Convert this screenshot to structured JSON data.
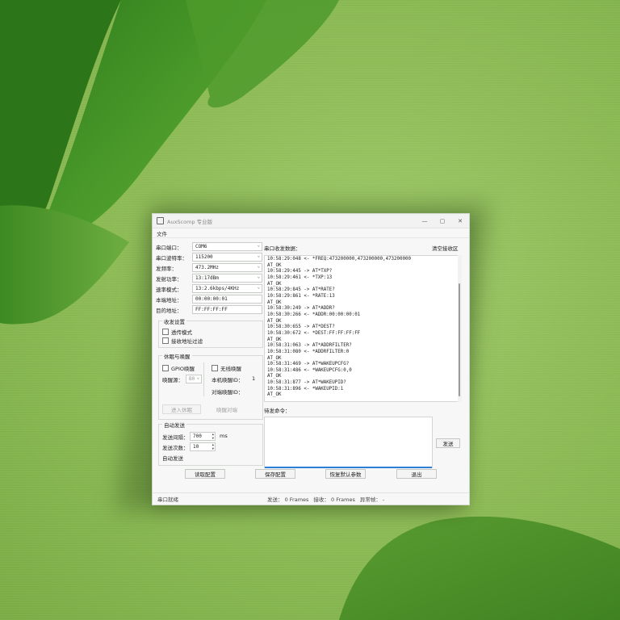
{
  "window": {
    "title": "AuxScomp 专业版"
  },
  "menu": {
    "items": [
      "文件"
    ]
  },
  "left": {
    "serial_port": {
      "label": "串口端口：",
      "value": "COM6"
    },
    "baud": {
      "label": "串口波特率：",
      "value": "115200"
    },
    "freq": {
      "label": "发频率：",
      "value": "473.2MHz"
    },
    "power": {
      "label": "发射功率：",
      "value": "13:17dBm"
    },
    "rate_mode": {
      "label": "速率模式：",
      "value": "13:2.6kbps/4KHz"
    },
    "local_addr": {
      "label": "本端地址：",
      "value": "00:00:00:01"
    },
    "dest_addr": {
      "label": "目的地址：",
      "value": "FF:FF:FF:FF"
    },
    "txrx_group": {
      "title": "收发设置",
      "transparent": "透传模式",
      "addr_filter": "接收地址过滤"
    },
    "sleep_group": {
      "title": "休眠与唤醒",
      "gpio": "GPIO唤醒",
      "wireless": "无线唤醒",
      "wake_source_label": "唤醒源：",
      "wake_source_value": "B0",
      "local_wake_id_label": "本机唤醒ID：",
      "local_wake_id_value": "1",
      "peer_wake_id_label": "对端唤醒ID：",
      "enter_sleep": "进入休眠",
      "wake_peer": "唤醒对端"
    },
    "auto_group": {
      "title": "自动发送",
      "interval_label": "发送间隔：",
      "interval_value": "700",
      "interval_unit": "ms",
      "count_label": "发送次数：",
      "count_value": "10",
      "auto_send": "自动发送"
    }
  },
  "right": {
    "log_title": "串口收发数据：",
    "clear_button": "清空接收区",
    "log_lines": [
      "10:58:29:048 <- *FREQ:473200000,473200000,473200000",
      "AT_OK",
      "10:58:29:445 -> AT*TXP?",
      "10:58:29:461 <- *TXP:13",
      "AT_OK",
      "10:58:29:845 -> AT*RATE?",
      "10:58:29:861 <- *RATE:13",
      "AT_OK",
      "10:58:30:249 -> AT*ADDR?",
      "10:58:30:266 <- *ADDR:00:00:00:01",
      "AT_OK",
      "10:58:30:655 -> AT*DEST?",
      "10:58:30:672 <- *DEST:FF:FF:FF:FF",
      "AT_OK",
      "10:58:31:063 -> AT*ADDRFILTER?",
      "10:58:31:080 <- *ADDRFILTER:0",
      "AT_OK",
      "10:58:31:469 -> AT*WAKEUPCFG?",
      "10:58:31:486 <- *WAKEUPCFG:0,0",
      "AT_OK",
      "10:58:31:877 -> AT*WAKEUPID?",
      "10:58:31:896 <- *WAKEUPID:1",
      "AT_OK"
    ],
    "send_title": "待发命令：",
    "send_button": "发送"
  },
  "bottom_buttons": {
    "read_config": "读取配置",
    "save_config": "保存配置",
    "restore_defaults": "恢复默认参数",
    "exit": "退出"
  },
  "status": {
    "left": "串口就绪",
    "sent": "发送： 0 Frames",
    "received": "接收： 0 Frames",
    "error": "异常帧： -"
  }
}
